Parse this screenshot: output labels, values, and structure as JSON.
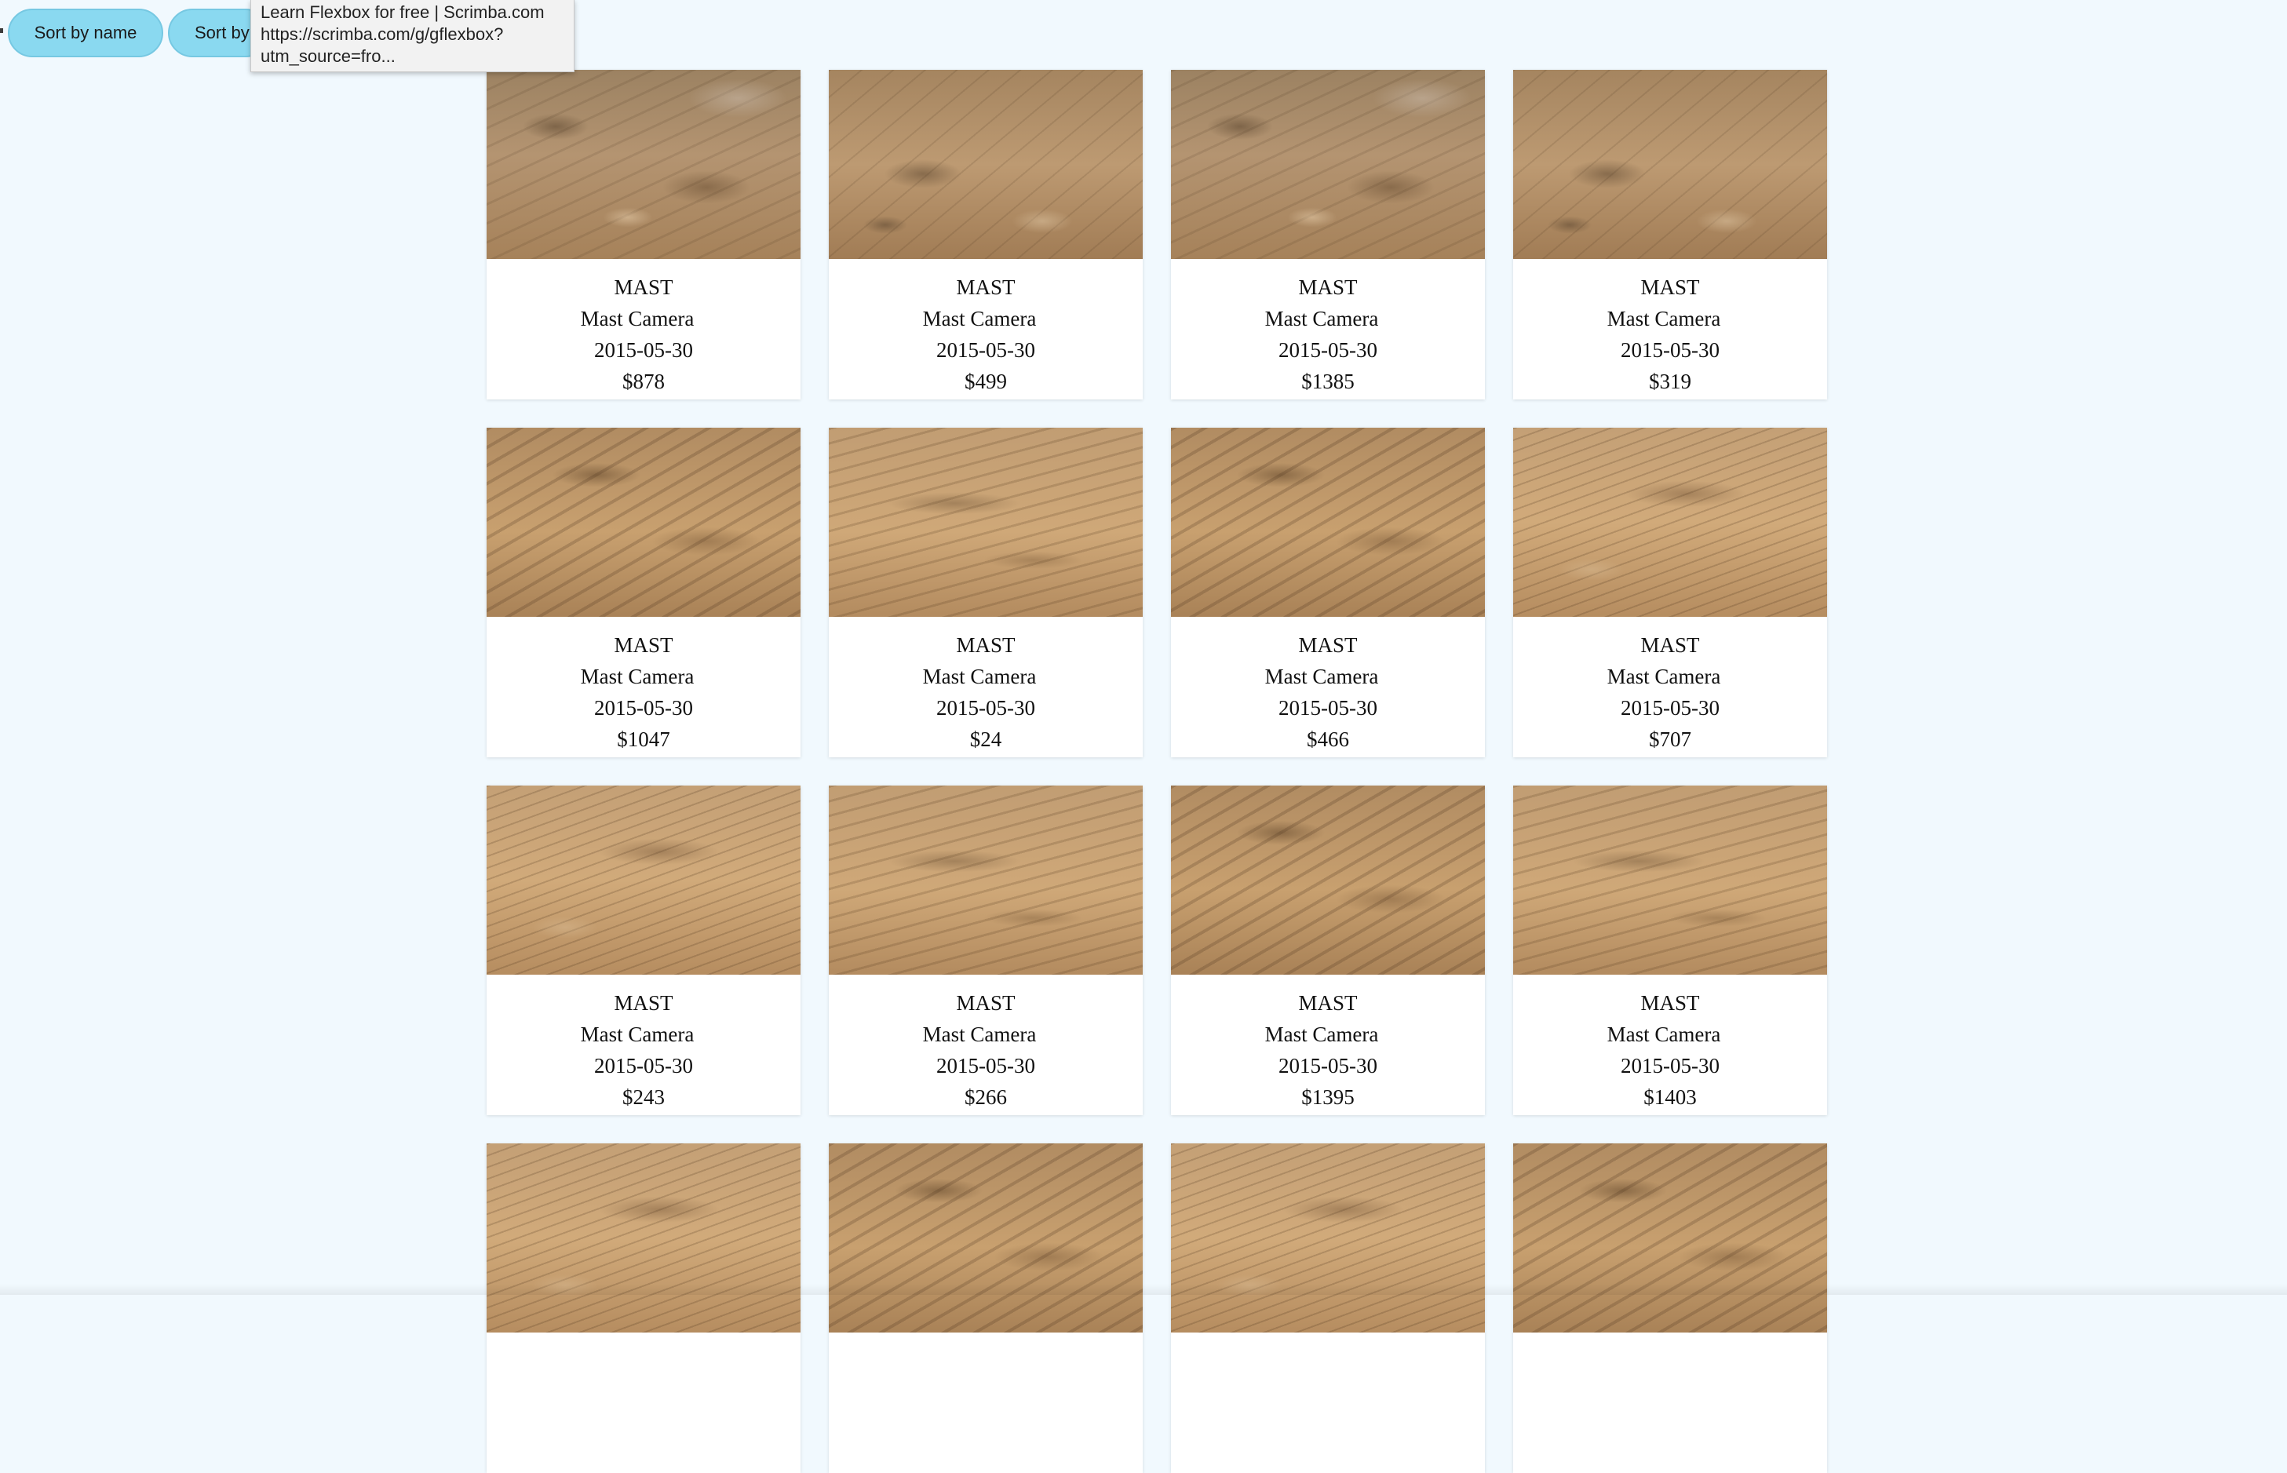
{
  "controls": {
    "sort_by_name_label": "Sort by name",
    "sort_by_other_label": "Sort by price"
  },
  "tooltip": {
    "line1": "Learn Flexbox for free | Scrimba.com",
    "line2": "https://scrimba.com/g/gflexbox?",
    "line3": "utm_source=fro..."
  },
  "cards": [
    {
      "camera": "MAST",
      "camera_full_name": "Mast Camera",
      "earth_date": "2015-05-30",
      "price": "$878",
      "image": "mars-rock-photo"
    },
    {
      "camera": "MAST",
      "camera_full_name": "Mast Camera",
      "earth_date": "2015-05-30",
      "price": "$499",
      "image": "mars-rock-photo"
    },
    {
      "camera": "MAST",
      "camera_full_name": "Mast Camera",
      "earth_date": "2015-05-30",
      "price": "$1385",
      "image": "mars-rock-photo"
    },
    {
      "camera": "MAST",
      "camera_full_name": "Mast Camera",
      "earth_date": "2015-05-30",
      "price": "$319",
      "image": "mars-rock-photo"
    },
    {
      "camera": "MAST",
      "camera_full_name": "Mast Camera",
      "earth_date": "2015-05-30",
      "price": "$1047",
      "image": "mars-rock-photo"
    },
    {
      "camera": "MAST",
      "camera_full_name": "Mast Camera",
      "earth_date": "2015-05-30",
      "price": "$24",
      "image": "mars-rock-photo"
    },
    {
      "camera": "MAST",
      "camera_full_name": "Mast Camera",
      "earth_date": "2015-05-30",
      "price": "$466",
      "image": "mars-rock-photo"
    },
    {
      "camera": "MAST",
      "camera_full_name": "Mast Camera",
      "earth_date": "2015-05-30",
      "price": "$707",
      "image": "mars-rock-photo"
    },
    {
      "camera": "MAST",
      "camera_full_name": "Mast Camera",
      "earth_date": "2015-05-30",
      "price": "$243",
      "image": "mars-rock-photo"
    },
    {
      "camera": "MAST",
      "camera_full_name": "Mast Camera",
      "earth_date": "2015-05-30",
      "price": "$266",
      "image": "mars-rock-photo"
    },
    {
      "camera": "MAST",
      "camera_full_name": "Mast Camera",
      "earth_date": "2015-05-30",
      "price": "$1395",
      "image": "mars-rock-photo"
    },
    {
      "camera": "MAST",
      "camera_full_name": "Mast Camera",
      "earth_date": "2015-05-30",
      "price": "$1403",
      "image": "mars-rock-photo"
    }
  ],
  "partial_cards": [
    {
      "image": "mars-rock-photo"
    },
    {
      "image": "mars-rock-photo"
    },
    {
      "image": "mars-rock-photo"
    },
    {
      "image": "mars-rock-photo"
    }
  ],
  "colors": {
    "page_background": "#f1f9fe",
    "button_background": "#8ad9f0",
    "card_background": "#ffffff",
    "tooltip_background": "#f2f2f2"
  }
}
